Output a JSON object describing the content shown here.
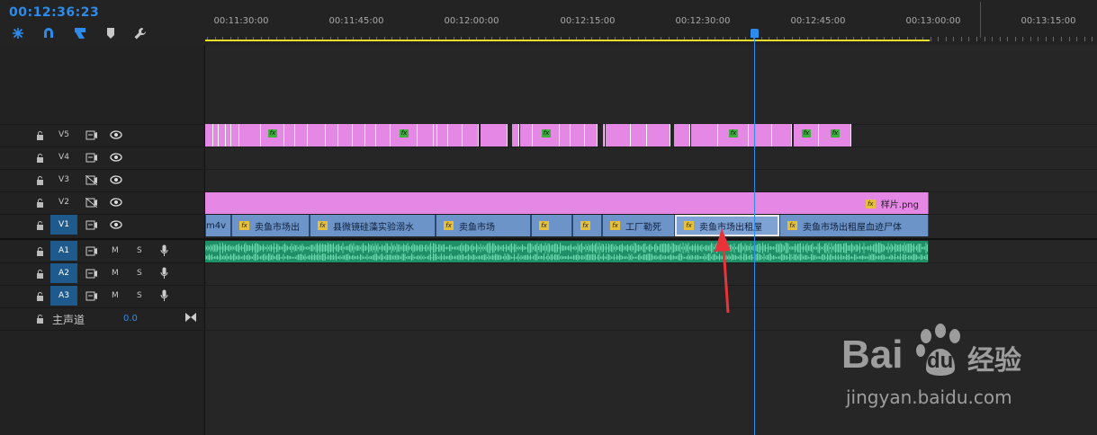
{
  "timecode": "00:12:36:23",
  "toolbar": {
    "icons": [
      "nest-sequence-icon",
      "snap-magnet-icon",
      "linked-selection-icon",
      "add-marker-icon",
      "wrench-settings-icon"
    ]
  },
  "ruler": {
    "ticks": [
      "00:11:30:00",
      "00:11:45:00",
      "00:12:00:00",
      "00:12:15:00",
      "00:12:30:00",
      "00:12:45:00",
      "00:13:00:00",
      "00:13:15:00"
    ]
  },
  "tracks": {
    "video": [
      {
        "name": "V5",
        "selected": false,
        "visible_icon": "eye-icon"
      },
      {
        "name": "V4",
        "selected": false,
        "visible_icon": "eye-icon"
      },
      {
        "name": "V3",
        "selected": false,
        "visible_icon": "eye-icon"
      },
      {
        "name": "V2",
        "selected": false,
        "visible_icon": "eye-icon"
      },
      {
        "name": "V1",
        "selected": true,
        "visible_icon": "eye-icon"
      }
    ],
    "audio": [
      {
        "name": "A1",
        "mute": "M",
        "solo": "S"
      },
      {
        "name": "A2",
        "mute": "M",
        "solo": "S"
      },
      {
        "name": "A3",
        "mute": "M",
        "solo": "S"
      }
    ],
    "master": {
      "label": "主声道",
      "value": "0.0"
    }
  },
  "clips": {
    "v2": {
      "label": "样片.png"
    },
    "v1": [
      "m4v",
      "卖鱼市场出",
      "县微镜硅藻实验溺水",
      "卖鱼市场",
      "",
      "",
      "工厂勒死",
      "卖鱼市场出租屋",
      "卖鱼市场出租屋血迹尸体"
    ]
  },
  "watermark": {
    "brand": "Bai",
    "brand_suffix": "du",
    "cn": "经验",
    "url": "jingyan.baidu.com"
  },
  "colors": {
    "accent": "#2d8ceb",
    "v5_clip": "#e587e5",
    "v2_clip": "#e587e5",
    "v1_clip": "#6d94c8",
    "audio_clip": "#1f8f67",
    "workarea": "#e6dc2a",
    "arrow": "#e8333a"
  }
}
